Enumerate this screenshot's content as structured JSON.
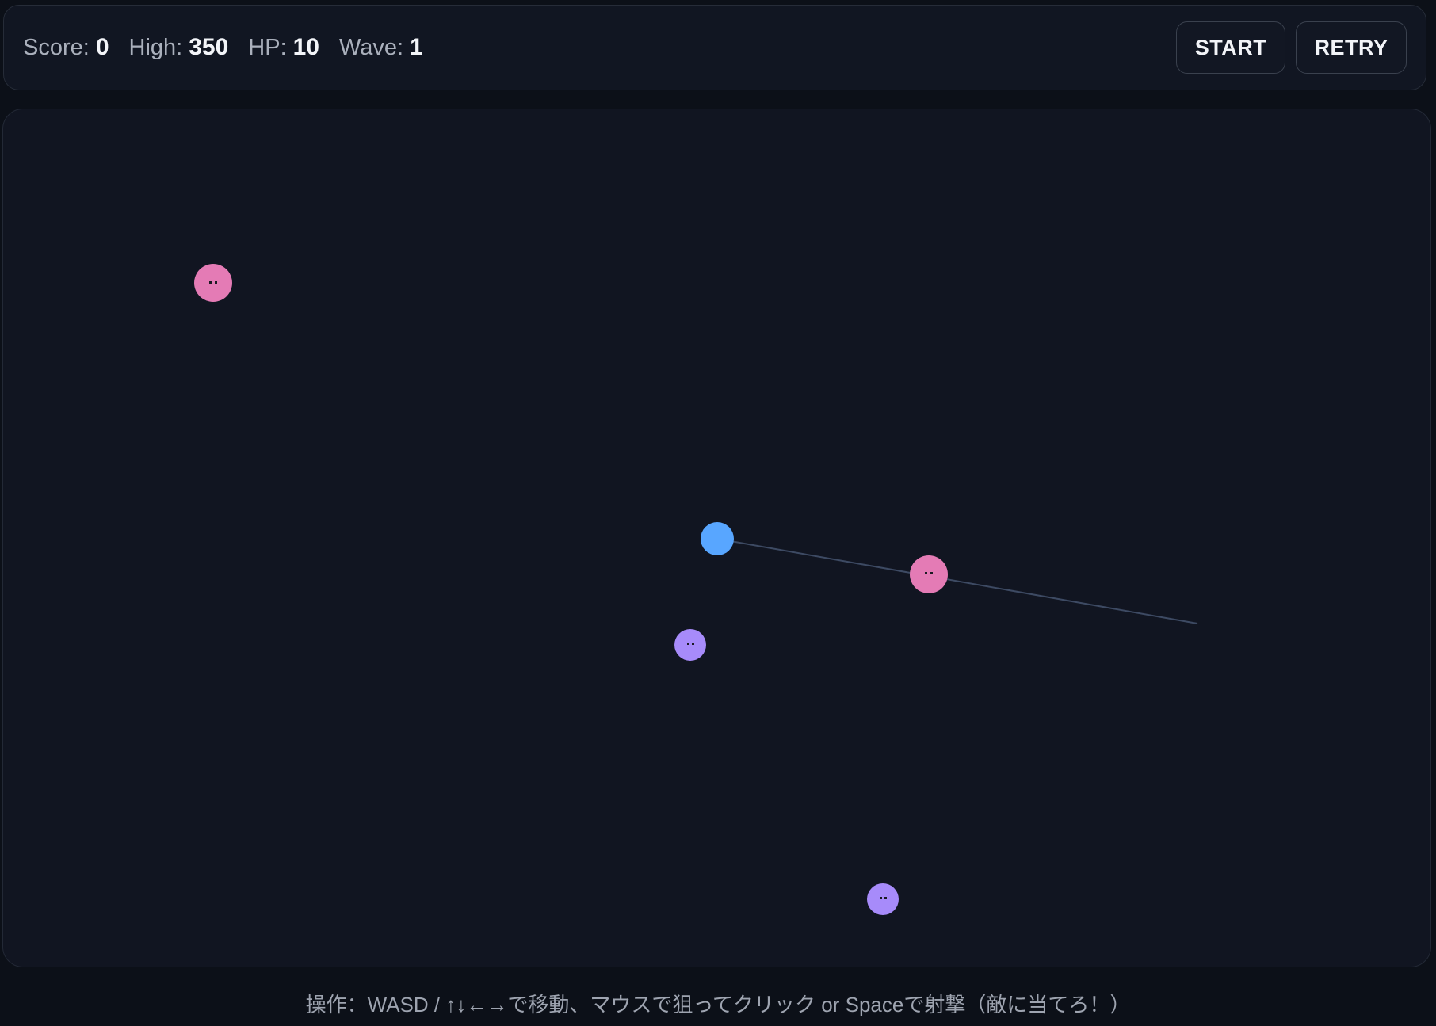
{
  "hud": {
    "stats": [
      {
        "label": "Score:",
        "value": "0"
      },
      {
        "label": "High:",
        "value": "350"
      },
      {
        "label": "HP:",
        "value": "10"
      },
      {
        "label": "Wave:",
        "value": "1"
      }
    ],
    "start_label": "START",
    "retry_label": "RETRY"
  },
  "colors": {
    "player": "#58a6ff",
    "enemy_pink": "#e47bb5",
    "enemy_purple": "#a78bfa",
    "aim_line": "#3d4a63"
  },
  "entities": {
    "player": {
      "icon": "player-circle"
    },
    "enemies": [
      {
        "type": "pink",
        "icon": "enemy-face-icon"
      },
      {
        "type": "pink",
        "icon": "enemy-face-icon"
      },
      {
        "type": "purple",
        "icon": "enemy-face-icon"
      },
      {
        "type": "purple",
        "icon": "enemy-face-icon"
      }
    ]
  },
  "footer": {
    "instructions": "操作：WASD / ↑↓←→で移動、マウスで狙ってクリック or Spaceで射撃（敵に当てろ！）"
  }
}
